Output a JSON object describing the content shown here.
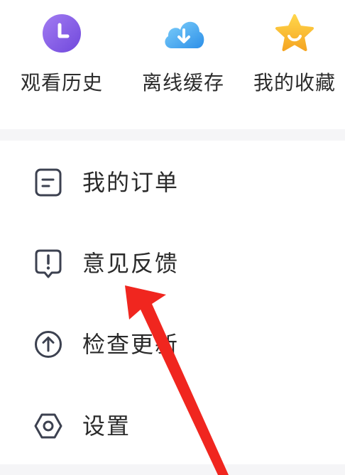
{
  "quick_actions": [
    {
      "label": "观看历史",
      "icon": "clock-icon",
      "color": "#8a63e8"
    },
    {
      "label": "离线缓存",
      "icon": "cloud-download-icon",
      "color": "#3aa5f0"
    },
    {
      "label": "我的收藏",
      "icon": "star-icon",
      "color": "#f7c02c"
    }
  ],
  "menu": [
    {
      "label": "我的订单",
      "icon": "order-icon"
    },
    {
      "label": "意见反馈",
      "icon": "feedback-icon"
    },
    {
      "label": "检查更新",
      "icon": "update-icon"
    },
    {
      "label": "设置",
      "icon": "settings-icon"
    }
  ],
  "colors": {
    "icon_stroke": "#3c4150",
    "annotation_arrow": "#f0261f",
    "band": "#f5f5f7"
  }
}
